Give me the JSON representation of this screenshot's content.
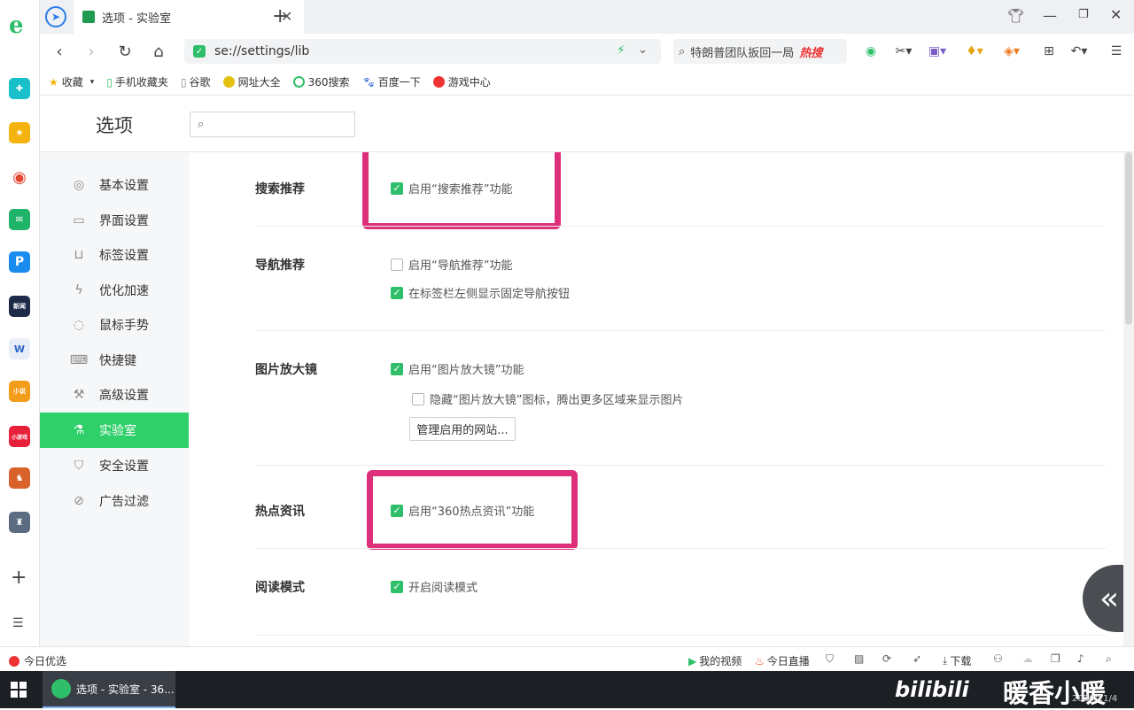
{
  "browser": {
    "tab_title": "选项 - 实验室",
    "url": "se://settings/lib",
    "hot_search": "特朗普团队扳回一局",
    "hot_badge": "热搜"
  },
  "bookmarks": [
    {
      "label": "收藏"
    },
    {
      "label": "手机收藏夹"
    },
    {
      "label": "谷歌"
    },
    {
      "label": "网址大全"
    },
    {
      "label": "360搜索"
    },
    {
      "label": "百度一下"
    },
    {
      "label": "游戏中心"
    }
  ],
  "settings": {
    "title": "选项",
    "search_placeholder": "",
    "nav": [
      {
        "label": "基本设置",
        "icon": "settings-icon"
      },
      {
        "label": "界面设置",
        "icon": "window-icon"
      },
      {
        "label": "标签设置",
        "icon": "tab-icon"
      },
      {
        "label": "优化加速",
        "icon": "lightning-icon"
      },
      {
        "label": "鼠标手势",
        "icon": "mouse-icon"
      },
      {
        "label": "快捷键",
        "icon": "keyboard-icon"
      },
      {
        "label": "高级设置",
        "icon": "wrench-icon"
      },
      {
        "label": "实验室",
        "icon": "flask-icon"
      },
      {
        "label": "安全设置",
        "icon": "shield-icon"
      },
      {
        "label": "广告过滤",
        "icon": "block-icon"
      }
    ],
    "active_nav": "实验室",
    "sections": {
      "search": {
        "label": "搜索推荐",
        "opt1": "启用“搜索推荐”功能"
      },
      "nav_rec": {
        "label": "导航推荐",
        "opt1": "启用“导航推荐”功能",
        "opt2": "在标签栏左侧显示固定导航按钮"
      },
      "magnifier": {
        "label": "图片放大镜",
        "opt1": "启用“图片放大镜”功能",
        "opt2": "隐藏“图片放大镜”图标，腾出更多区域来显示图片",
        "button": "管理启用的网站..."
      },
      "hotspot": {
        "label": "热点资讯",
        "opt1": "启用“360热点资讯”功能"
      },
      "reading": {
        "label": "阅读模式",
        "opt1": "开启阅读模式"
      }
    }
  },
  "statusbar": {
    "left": "今日优选",
    "video": "我的视频",
    "live": "今日直播",
    "download": "下载"
  },
  "taskbar": {
    "window_title": "选项 - 实验室 - 36...",
    "watermark": "暖香小暖",
    "date": "2020/11/4"
  },
  "colors": {
    "accent": "#2fcf6a",
    "highlight": "#dd2f7a"
  }
}
